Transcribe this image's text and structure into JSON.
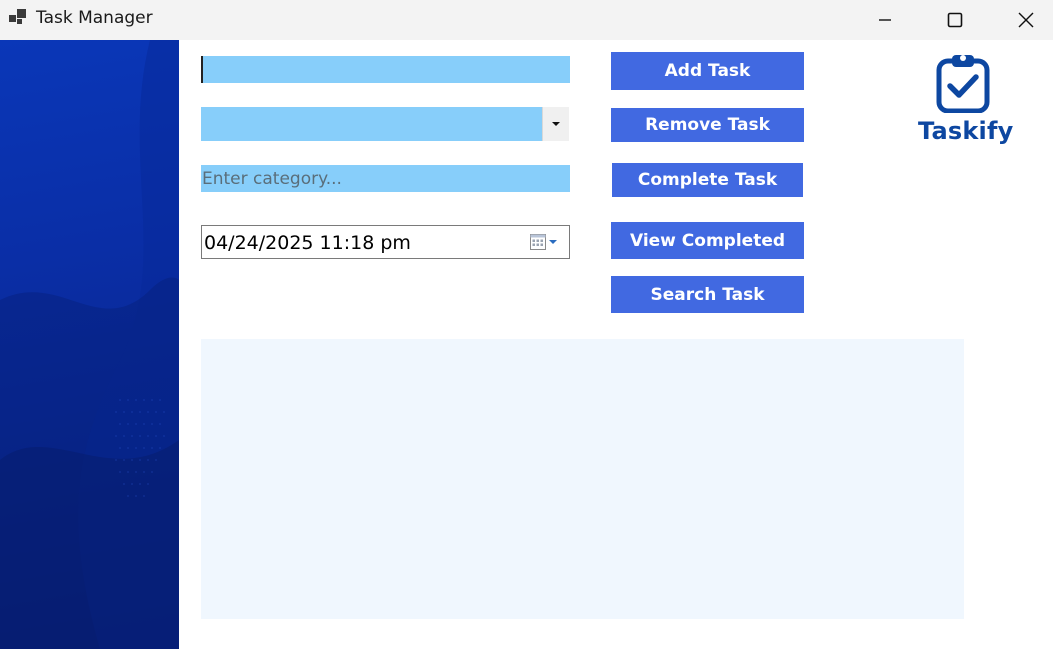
{
  "window": {
    "title": "Task Manager",
    "icons": {
      "app": "app-icon",
      "minimize": "minimize-icon",
      "maximize": "maximize-icon",
      "close": "close-icon"
    }
  },
  "form": {
    "task_input": {
      "value": "",
      "placeholder": ""
    },
    "priority_combo": {
      "selected": ""
    },
    "category_input": {
      "value": "",
      "placeholder": "Enter category..."
    },
    "due_date": {
      "value": "04/24/2025 11:18 pm"
    }
  },
  "buttons": {
    "add": "Add Task",
    "remove": "Remove Task",
    "complete": "Complete Task",
    "view_completed": "View Completed",
    "search": "Search Task"
  },
  "brand": {
    "name": "Taskify",
    "icon": "clipboard-check-icon",
    "color": "#0d47a1"
  },
  "colors": {
    "button": "#4169e1",
    "input": "#87cefa",
    "list_background": "#f0f7fe",
    "sidebar": "#0a2ea6"
  },
  "task_list": {
    "items": []
  }
}
